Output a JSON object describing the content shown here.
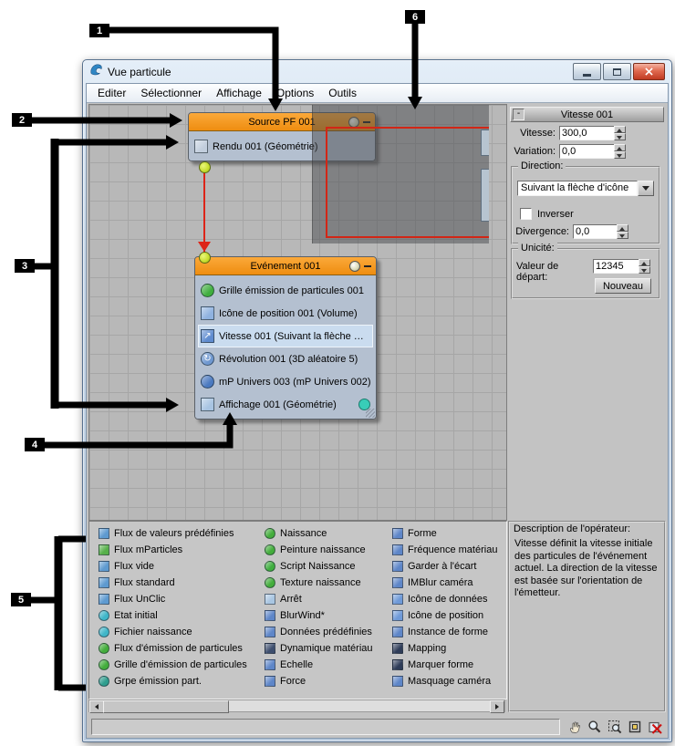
{
  "window": {
    "title": "Vue particule"
  },
  "menu": {
    "items": [
      "Editer",
      "Sélectionner",
      "Affichage",
      "Options",
      "Outils"
    ]
  },
  "canvas": {
    "source_node": {
      "title": "Source PF 001",
      "rows": [
        {
          "label": "Rendu 001 (Géométrie)",
          "icon_shape": "square",
          "icon_color": "#c2cedd",
          "glyph": ""
        }
      ]
    },
    "event_node": {
      "title": "Evénement 001",
      "rows": [
        {
          "label": "Grille émission de particules 001",
          "icon_shape": "circle",
          "icon_color": "#3fae3f",
          "glyph": "",
          "selected": false
        },
        {
          "label": "Icône de position 001 (Volume)",
          "icon_shape": "square",
          "icon_color": "#8fb2e0",
          "glyph": "",
          "selected": false
        },
        {
          "label": "Vitesse 001 (Suivant la flèche …",
          "icon_shape": "square",
          "icon_color": "#5f8cd0",
          "glyph": "↗",
          "selected": true
        },
        {
          "label": "Révolution 001 (3D aléatoire 5)",
          "icon_shape": "circle",
          "icon_color": "#6f98d0",
          "glyph": "↻",
          "selected": false
        },
        {
          "label": "mP Univers 003 (mP Univers 002)",
          "icon_shape": "circle",
          "icon_color": "#4a79c0",
          "glyph": "",
          "selected": false
        },
        {
          "label": "Affichage 001 (Géométrie)",
          "icon_shape": "square",
          "icon_color": "#a8c4e2",
          "glyph": "",
          "selected": false
        }
      ]
    }
  },
  "params": {
    "rollout_title": "Vitesse 001",
    "collapse_glyph": "-",
    "speed_label": "Vitesse:",
    "speed_value": "300,0",
    "variation_label": "Variation:",
    "variation_value": "0,0",
    "direction_group": "Direction:",
    "direction_value": "Suivant la flèche d'icône",
    "reverse_label": "Inverser",
    "divergence_label": "Divergence:",
    "divergence_value": "0,0",
    "uniqueness_group": "Unicité:",
    "seed_label": "Valeur de départ:",
    "seed_value": "12345",
    "new_button": "Nouveau"
  },
  "depot": {
    "columns": [
      {
        "items": [
          {
            "label": "Flux de valeurs prédéfinies",
            "icon_shape": "square",
            "icon_color": "#5e9ad0"
          },
          {
            "label": "Flux mParticles",
            "icon_shape": "square",
            "icon_color": "#57b04a"
          },
          {
            "label": "Flux vide",
            "icon_shape": "square",
            "icon_color": "#5e9ad0"
          },
          {
            "label": "Flux standard",
            "icon_shape": "square",
            "icon_color": "#5e9ad0"
          },
          {
            "label": "Flux UnClic",
            "icon_shape": "square",
            "icon_color": "#5e9ad0"
          },
          {
            "label": "Etat initial",
            "icon_shape": "circle",
            "icon_color": "#3fb6c8"
          },
          {
            "label": "Fichier naissance",
            "icon_shape": "circle",
            "icon_color": "#3fb6c8"
          },
          {
            "label": "Flux d'émission de particules",
            "icon_shape": "circle",
            "icon_color": "#43ad3c"
          },
          {
            "label": "Grille d'émission de particules",
            "icon_shape": "circle",
            "icon_color": "#43ad3c"
          },
          {
            "label": "Grpe émission part.",
            "icon_shape": "circle",
            "icon_color": "#2f9e8e"
          }
        ]
      },
      {
        "items": [
          {
            "label": "Naissance",
            "icon_shape": "circle",
            "icon_color": "#43ad3c"
          },
          {
            "label": "Peinture naissance",
            "icon_shape": "circle",
            "icon_color": "#43ad3c"
          },
          {
            "label": "Script Naissance",
            "icon_shape": "circle",
            "icon_color": "#3fae3f"
          },
          {
            "label": "Texture naissance",
            "icon_shape": "circle",
            "icon_color": "#43ad3c"
          },
          {
            "label": "Arrêt",
            "icon_shape": "square",
            "icon_color": "#a9c6e2"
          },
          {
            "label": "BlurWind*",
            "icon_shape": "square",
            "icon_color": "#5e86c8"
          },
          {
            "label": "Données prédéfinies",
            "icon_shape": "square",
            "icon_color": "#5e86c8"
          },
          {
            "label": "Dynamique matériau",
            "icon_shape": "square",
            "icon_color": "#3d4e6e"
          },
          {
            "label": "Echelle",
            "icon_shape": "square",
            "icon_color": "#5e86c8"
          },
          {
            "label": "Force",
            "icon_shape": "square",
            "icon_color": "#5e86c8"
          }
        ]
      },
      {
        "items": [
          {
            "label": "Forme",
            "icon_shape": "square",
            "icon_color": "#5e86c8"
          },
          {
            "label": "Fréquence matériau",
            "icon_shape": "square",
            "icon_color": "#5e86c8"
          },
          {
            "label": "Garder à l'écart",
            "icon_shape": "square",
            "icon_color": "#5e86c8"
          },
          {
            "label": "IMBlur caméra",
            "icon_shape": "square",
            "icon_color": "#5e86c8"
          },
          {
            "label": "Icône de données",
            "icon_shape": "square",
            "icon_color": "#6f9ad8"
          },
          {
            "label": "Icône de position",
            "icon_shape": "square",
            "icon_color": "#6f9ad8"
          },
          {
            "label": "Instance de forme",
            "icon_shape": "square",
            "icon_color": "#5e86c8"
          },
          {
            "label": "Mapping",
            "icon_shape": "square",
            "icon_color": "#2e3c58"
          },
          {
            "label": "Marquer forme",
            "icon_shape": "square",
            "icon_color": "#2e3c58"
          },
          {
            "label": "Masquage caméra",
            "icon_shape": "square",
            "icon_color": "#5e86c8"
          }
        ]
      }
    ]
  },
  "description": {
    "title": "Description de l'opérateur:",
    "text": "Vitesse définit la vitesse initiale des particules de l'événement actuel. La direction de la vitesse est basée sur l'orientation de l'émetteur."
  },
  "statusbar": {
    "tools": [
      "pan",
      "zoom",
      "region-zoom",
      "zoom-extents",
      "zoom-extents-selected"
    ]
  },
  "callouts": {
    "n1": "1",
    "n2": "2",
    "n3": "3",
    "n4": "4",
    "n5": "5",
    "n6": "6"
  }
}
